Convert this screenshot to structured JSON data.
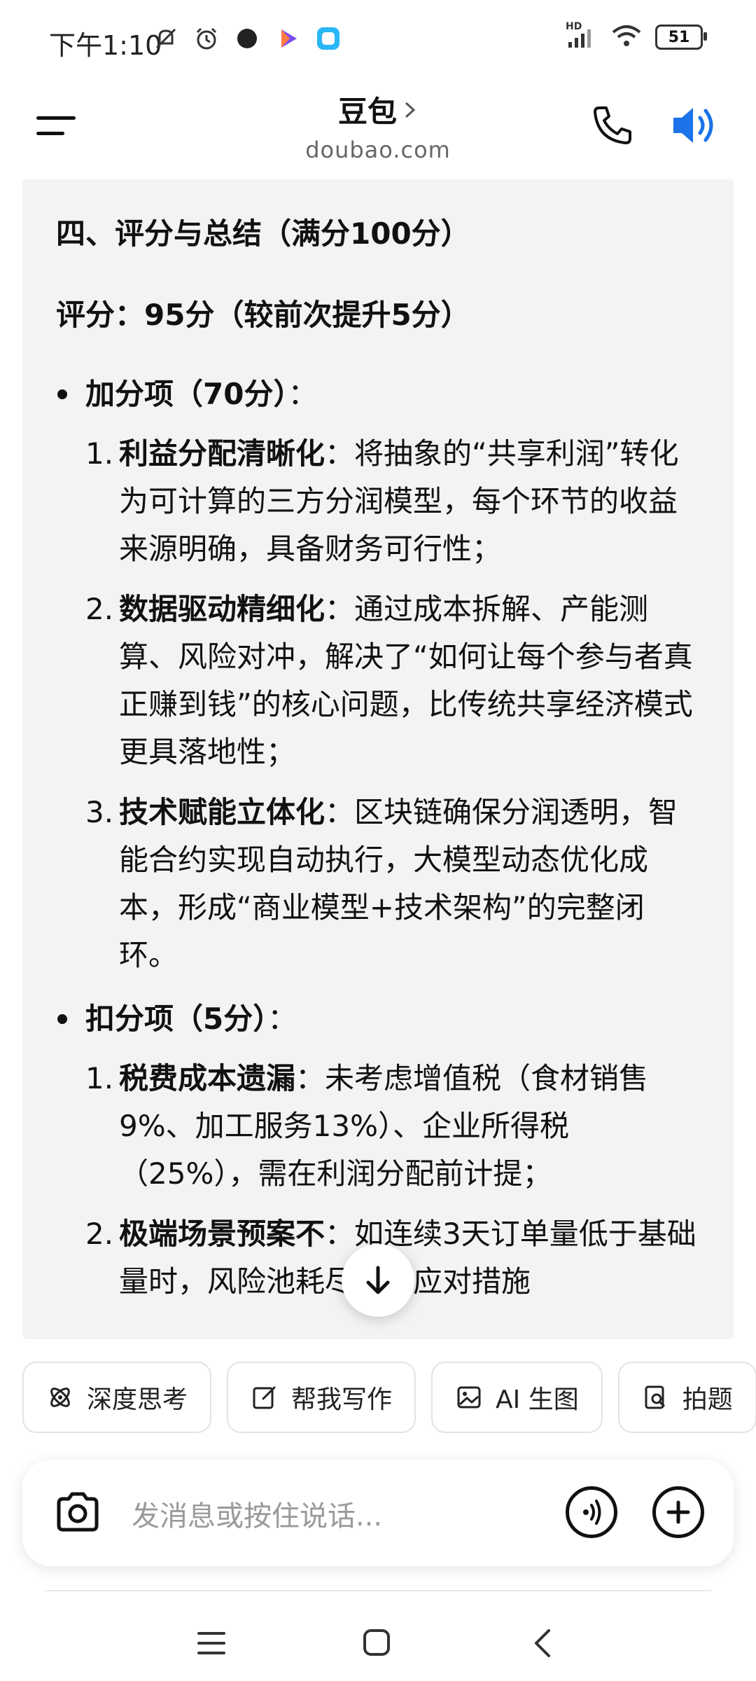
{
  "status": {
    "time": "下午1:10",
    "battery": "51",
    "network_label": "HD"
  },
  "header": {
    "title": "豆包",
    "subtitle": "doubao.com"
  },
  "content": {
    "section_title": "四、评分与总结（满分100分）",
    "score": "评分：95分（较前次提升5分）",
    "plus": {
      "label": "加分项（70分）",
      "suffix": "：",
      "items": [
        {
          "num": "1.",
          "bold": "利益分配清晰化",
          "text": "：将抽象的“共享利润”转化为可计算的三方分润模型，每个环节的收益来源明确，具备财务可行性；"
        },
        {
          "num": "2.",
          "bold": "数据驱动精细化",
          "text": "：通过成本拆解、产能测算、风险对冲，解决了“如何让每个参与者真正赚到钱”的核心问题，比传统共享经济模式更具落地性；"
        },
        {
          "num": "3.",
          "bold": "技术赋能立体化",
          "text": "：区块链确保分润透明，智能合约实现自动执行，大模型动态优化成本，形成“商业模型+技术架构”的完整闭环。"
        }
      ]
    },
    "minus": {
      "label": "扣分项（5分）",
      "suffix": "：",
      "items": [
        {
          "num": "1.",
          "bold": "税费成本遗漏",
          "text": "：未考虑增值税（食材销售9%、加工服务13%）、企业所得税（25%），需在利润分配前计提；"
        },
        {
          "num": "2.",
          "bold": "极端场景预案不",
          "text": "：如连续3天订单量低于基础量时，风险池耗尽后的应对措施"
        }
      ]
    }
  },
  "chips": [
    {
      "label": "深度思考",
      "icon": "atom-icon"
    },
    {
      "label": "帮我写作",
      "icon": "edit-icon"
    },
    {
      "label": "AI 生图",
      "icon": "image-icon"
    },
    {
      "label": "拍题",
      "icon": "search-doc-icon"
    }
  ],
  "input": {
    "placeholder": "发消息或按住说话..."
  }
}
